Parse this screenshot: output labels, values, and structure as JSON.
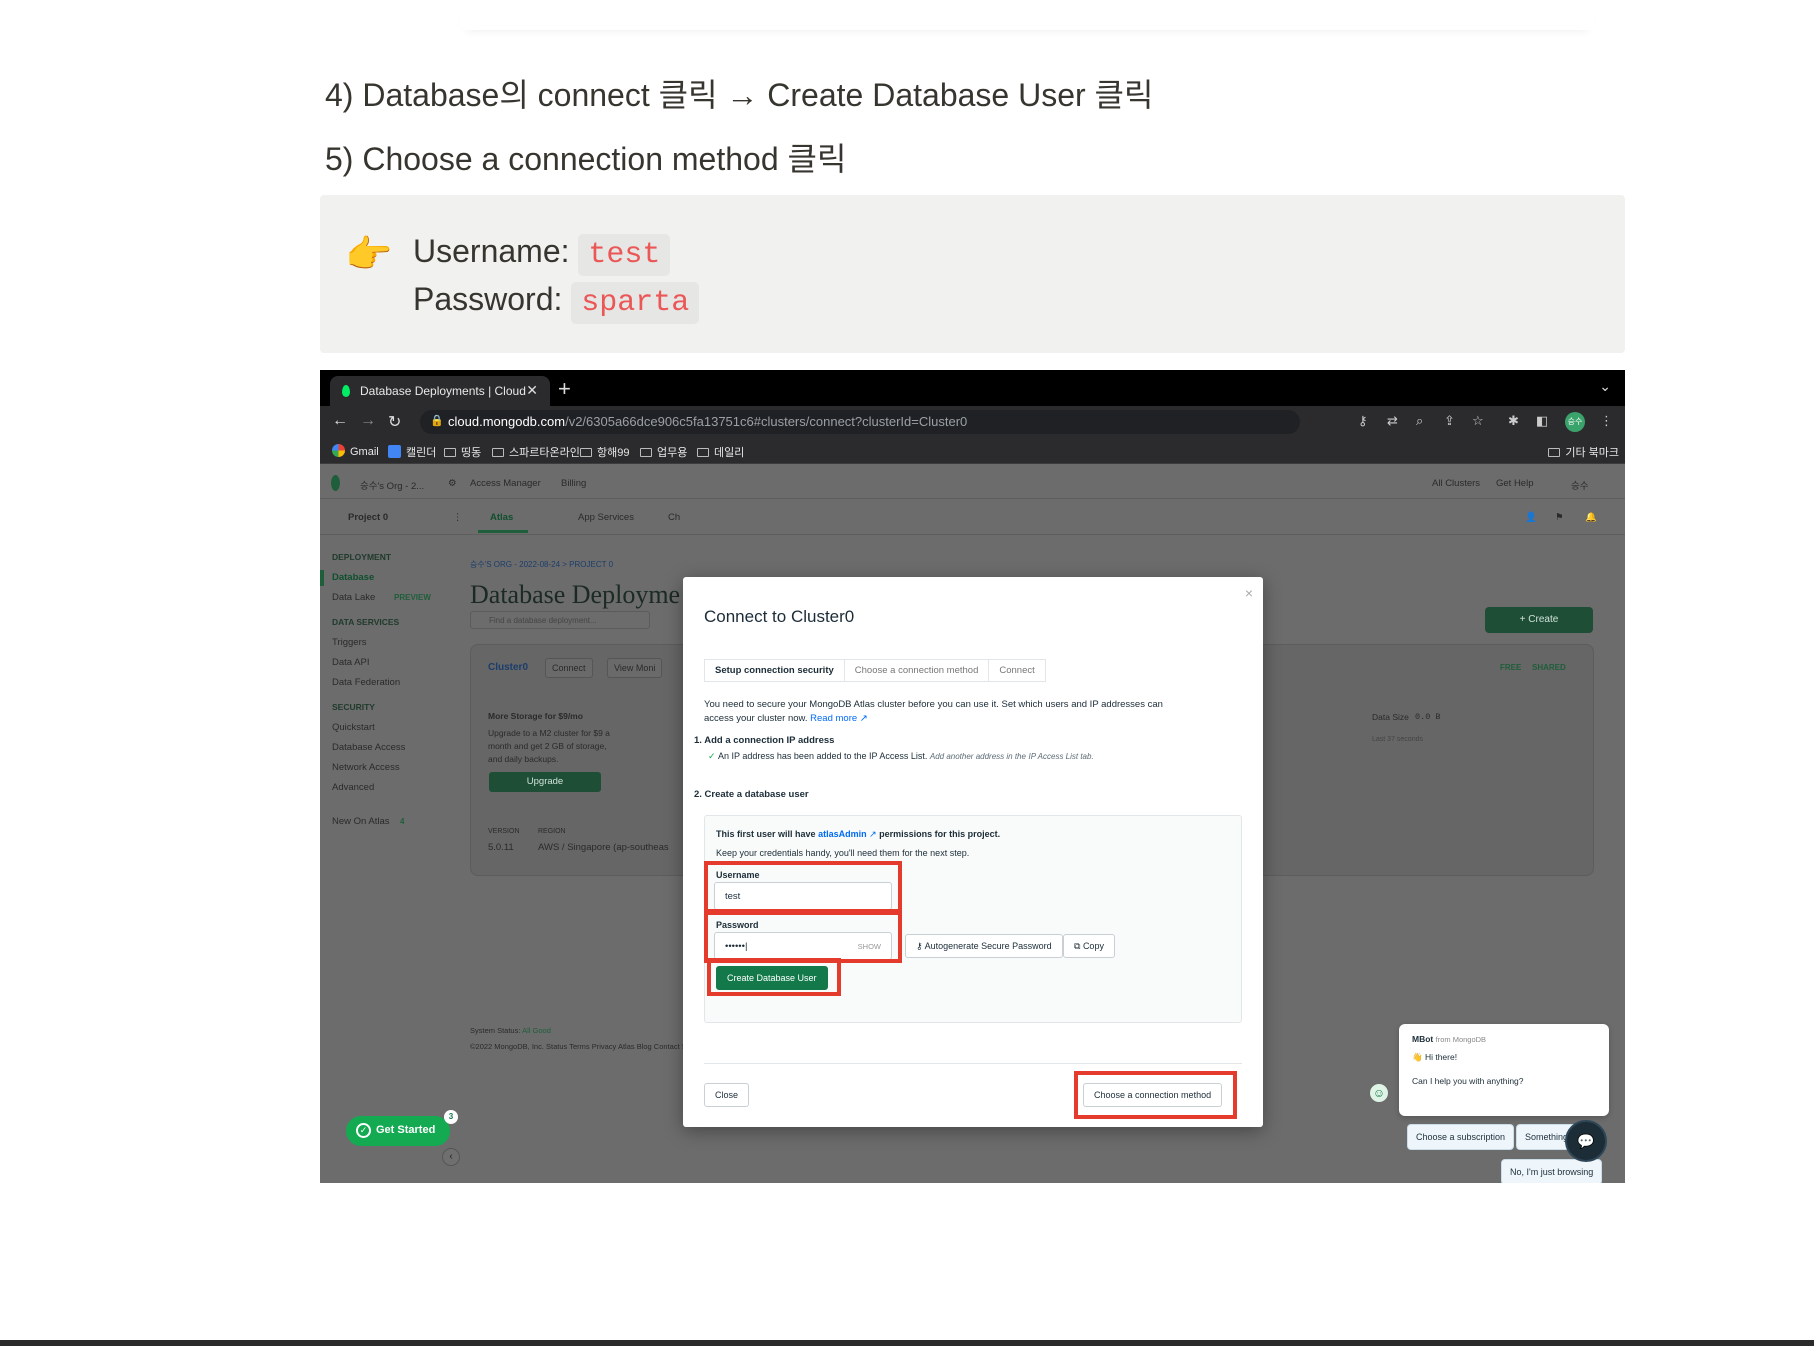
{
  "doc": {
    "step4": "4) Database의 connect 클릭 → Create Database User 클릭",
    "step5": "5) Choose a connection method 클릭",
    "callout": {
      "emoji": "👉",
      "username_label": "Username:",
      "username_value": "test",
      "password_label": "Password:",
      "password_value": "sparta"
    }
  },
  "browser": {
    "tab_title": "Database Deployments | Cloud",
    "url_host": "cloud.mongodb.com",
    "url_path": "/v2/6305a66dce906c5fa13751c6#clusters/connect?clusterId=Cluster0",
    "bookmarks": [
      "Gmail",
      "캘린더",
      "띵동",
      "스파르타온라인",
      "항해99",
      "업무용",
      "데일리"
    ],
    "bookmarks_right": "기타 북마크",
    "profile": "승수"
  },
  "atlas": {
    "org": "승수's Org - 2...",
    "access_manager": "Access Manager",
    "billing": "Billing",
    "all_clusters": "All Clusters",
    "get_help": "Get Help",
    "user": "승수",
    "project": "Project 0",
    "tabs": [
      "Atlas",
      "App Services",
      "Ch"
    ],
    "breadcrumb": "승수'S ORG - 2022-08-24 > PROJECT 0",
    "page_title": "Database Deployme",
    "search_placeholder": "Find a database deployment...",
    "create_label": "+ Create",
    "sidebar": {
      "deployment": "DEPLOYMENT",
      "database": "Database",
      "data_lake": "Data Lake",
      "preview": "PREVIEW",
      "data_services": "DATA SERVICES",
      "triggers": "Triggers",
      "data_api": "Data API",
      "data_federation": "Data Federation",
      "security": "SECURITY",
      "quickstart": "Quickstart",
      "database_access": "Database Access",
      "network_access": "Network Access",
      "advanced": "Advanced",
      "new_on_atlas": "New On Atlas",
      "new_count": "4"
    },
    "cluster": {
      "name": "Cluster0",
      "connect": "Connect",
      "view_monitoring": "View Moni",
      "free": "FREE",
      "shared": "SHARED",
      "storage_title": "More Storage for $9/mo",
      "storage_desc_1": "Upgrade to a M2 cluster for $9 a",
      "storage_desc_2": "month and get 2 GB of storage,",
      "storage_desc_3": "and daily backups.",
      "upgrade": "Upgrade",
      "version_label": "VERSION",
      "version": "5.0.11",
      "region_label": "REGION",
      "region": "AWS / Singapore (ap-southeas",
      "data_size_label": "Data Size",
      "data_size": "0.0 B",
      "last_seconds": "Last 37 seconds"
    },
    "footer": {
      "status_label": "System Status:",
      "status_value": "All Good",
      "links": "©2022 MongoDB, Inc.   Status   Terms   Privacy   Atlas Blog   Contact Sales"
    }
  },
  "modal": {
    "title": "Connect to Cluster0",
    "steps": [
      "Setup connection security",
      "Choose a connection method",
      "Connect"
    ],
    "intro_1": "You need to secure your MongoDB Atlas cluster before you can use it. Set which users and IP addresses can",
    "intro_2": "access your cluster now.",
    "read_more": "Read more",
    "ip_heading": "1. Add a connection IP address",
    "ip_added": "An IP address has been added to the IP Access List.",
    "ip_another": "Add another address in the",
    "ip_tab_link": "IP Access List tab.",
    "user_heading": "2. Create a database user",
    "perm_prefix": "This first user will have",
    "perm_role": "atlasAdmin",
    "perm_suffix": "permissions for this project.",
    "handy": "Keep your credentials handy, you'll need them for the next step.",
    "username_label": "Username",
    "username_value": "test",
    "password_label": "Password",
    "password_value": "••••••|",
    "show": "SHOW",
    "autogen": "Autogenerate Secure Password",
    "copy": "Copy",
    "create_user": "Create Database User",
    "close": "Close",
    "choose_method": "Choose a connection method"
  },
  "chat": {
    "from_name": "MBot",
    "from_rest": "from MongoDB",
    "hi": "👋 Hi there!",
    "question": "Can I help you with anything?",
    "chip1": "Choose a subscription",
    "chip2": "Something else",
    "chip3": "No, I'm just browsing"
  },
  "get_started": {
    "label": "Get Started",
    "count": "3"
  }
}
